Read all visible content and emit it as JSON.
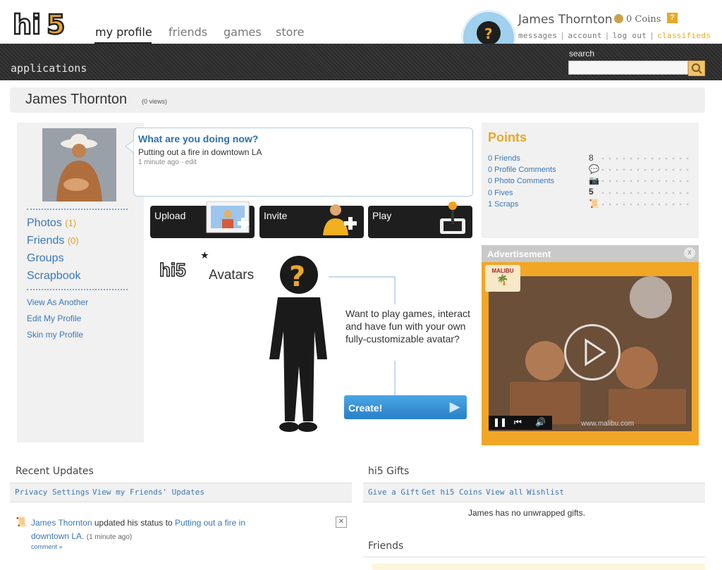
{
  "header": {
    "logo_text": "hi5",
    "nav": [
      {
        "label": "my profile"
      },
      {
        "label": "friends"
      },
      {
        "label": "games"
      },
      {
        "label": "store"
      }
    ],
    "username": "James Thornton",
    "coins": "0 Coins",
    "help_badge": "?",
    "links": [
      "messages",
      "account",
      "log out",
      "classifieds"
    ],
    "applications_label": "applications",
    "search_label": "search",
    "search_value": ""
  },
  "profile": {
    "name": "James Thornton",
    "views": "(0 views)"
  },
  "left_nav": {
    "photos_label": "Photos",
    "photos_count": "(1)",
    "friends_label": "Friends",
    "friends_count": "(0)",
    "groups_label": "Groups",
    "scrapbook_label": "Scrapbook",
    "view_as_another": "View As Another",
    "edit_profile": "Edit My Profile",
    "skin_profile": "Skin my Profile"
  },
  "status": {
    "question": "What are you doing now?",
    "text": "Putting out a fire in downtown LA",
    "time": "1 minute ago",
    "edit": "edit"
  },
  "actions": {
    "upload": "Upload",
    "invite": "Invite",
    "play": "Play"
  },
  "avatars_promo": {
    "logo": "hi5",
    "word": "Avatars",
    "text": "Want to play games, interact and have fun with your own fully-customizable avatar?",
    "create": "Create!"
  },
  "points": {
    "title": "Points",
    "rows": [
      {
        "label": "0 Friends",
        "icon": "8"
      },
      {
        "label": "0 Profile Comments",
        "icon": "💬"
      },
      {
        "label": "0 Photo Comments",
        "icon": "📷"
      },
      {
        "label": "0 Fives",
        "icon": "5"
      },
      {
        "label": "1 Scraps",
        "icon": "📜"
      }
    ]
  },
  "ad": {
    "label": "Advertisement",
    "close": "x",
    "logo": "MALIBU",
    "url": "www.malibu.com"
  },
  "recent_updates": {
    "title": "Recent Updates",
    "privacy": "Privacy Settings",
    "view_friends": "View my Friends' Updates",
    "item_name": "James Thornton",
    "item_mid": "updated his status to",
    "item_status_1": "Putting out a fire in",
    "item_status_2": "downtown LA.",
    "item_time": "(1 minute ago)",
    "comment": "comment »"
  },
  "gifts": {
    "title": "hi5 Gifts",
    "give": "Give a Gift",
    "get_coins": "Get hi5 Coins",
    "view_all": "View all",
    "wishlist": "Wishlist",
    "none": "James has no unwrapped gifts."
  },
  "friends_section": {
    "title": "Friends"
  }
}
